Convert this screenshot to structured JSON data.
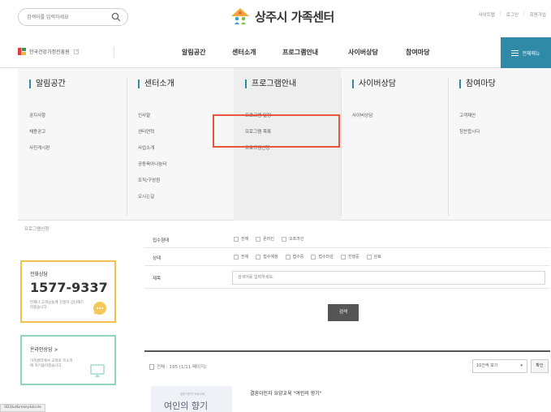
{
  "header": {
    "search_placeholder": "검색어를 입력하세요",
    "logo_text": "상주시 가족센터",
    "util": [
      "사이트맵",
      "로그인",
      "회원가입"
    ]
  },
  "gnb": {
    "org_label": "한국건강가정진흥원",
    "menus": [
      "알림공간",
      "센터소개",
      "프로그램안내",
      "사이버상담",
      "참여마당"
    ],
    "allmenu_label": "전체메뉴"
  },
  "mega": {
    "columns": [
      {
        "title": "알림공간",
        "items": [
          "공지사항",
          "채용공고",
          "사진게시판"
        ]
      },
      {
        "title": "센터소개",
        "items": [
          "인사말",
          "센터연혁",
          "사업소개",
          "공동육아나눔터",
          "조직/구성원",
          "오시는길"
        ]
      },
      {
        "title": "프로그램안내",
        "items": [
          "프로그램 일정",
          "프로그램 목록",
          "프로그램신청"
        ]
      },
      {
        "title": "사이버상담",
        "items": [
          "사이버상담"
        ]
      },
      {
        "title": "참여마당",
        "items": [
          "고객제안",
          "칭찬합시다"
        ]
      }
    ]
  },
  "sidebar": {
    "link": "프로그램신청",
    "phone_title": "전화상담",
    "phone_number": "1577-9337",
    "phone_desc": "언제나 고객님들께 친절히 상담해드리겠습니다.",
    "online_title": "온라인상담 >",
    "online_desc": "가족센터에서 고객의 목소리에 귀기울이겠습니다."
  },
  "filter": {
    "type_label": "접수형태",
    "type_options": [
      "전체",
      "온라인",
      "오프라인"
    ],
    "status_label": "상태",
    "status_options": [
      "전체",
      "접수예정",
      "접수중",
      "접수마감",
      "진행중",
      "완료"
    ],
    "title_label": "제목",
    "title_placeholder": "검색어를 입력하세요.",
    "search_button": "검색"
  },
  "list": {
    "total_text": "전체 : 195 (1/11 페이지)",
    "page_size_value": "10건씩 보기",
    "page_size_button": "확인",
    "items": [
      {
        "title": "결혼이민자 요양교육 \"여인의 향기\"",
        "thumb_small": "결혼이민자 요양교육",
        "thumb_big": "여인의 향기"
      }
    ]
  },
  "status_bar": {
    "url": "SD2&d&mkey&bcde"
  },
  "colors": {
    "accent": "#2f8aa8",
    "highlight": "#e8553d",
    "phone_border": "#f3c150",
    "online_border": "#8fd3c2"
  }
}
